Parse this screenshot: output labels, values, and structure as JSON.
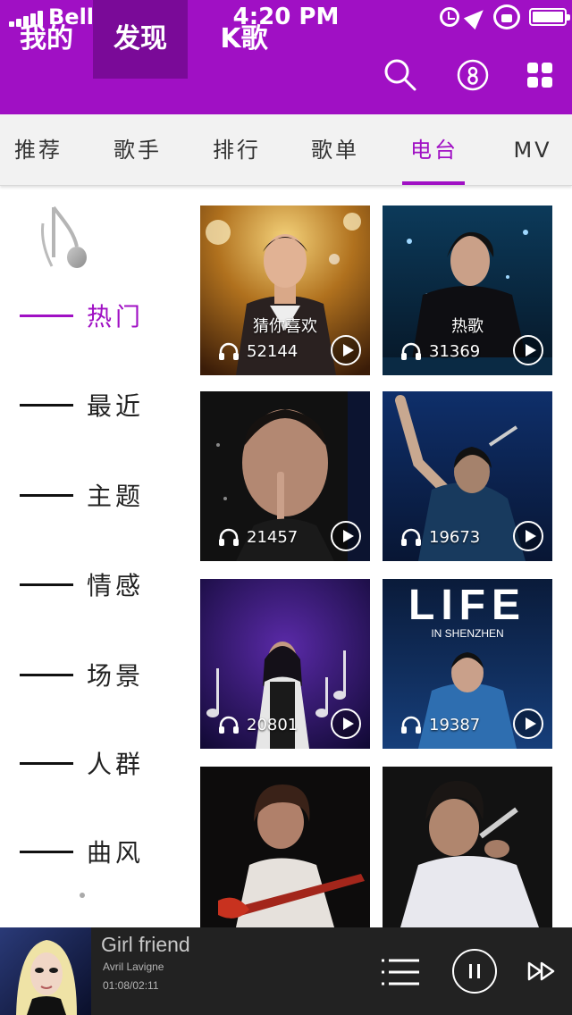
{
  "status_bar": {
    "carrier": "Bell",
    "time": "4:20 PM",
    "battery_level": 1.0
  },
  "header": {
    "tabs": [
      {
        "label": "我的",
        "active": false
      },
      {
        "label": "发现",
        "active": true
      },
      {
        "label": "K歌",
        "active": false
      }
    ],
    "icons": [
      "search-icon",
      "user-icon",
      "grid-menu-icon"
    ]
  },
  "category_tabs": {
    "items": [
      {
        "label": "推荐"
      },
      {
        "label": "歌手"
      },
      {
        "label": "排行"
      },
      {
        "label": "歌单"
      },
      {
        "label": "电台"
      },
      {
        "label": "MV"
      }
    ],
    "active_index": 4
  },
  "side_menu": {
    "items": [
      {
        "label": "热门"
      },
      {
        "label": "最近"
      },
      {
        "label": "主题"
      },
      {
        "label": "情感"
      },
      {
        "label": "场景"
      },
      {
        "label": "人群"
      },
      {
        "label": "曲风"
      }
    ],
    "active_index": 0
  },
  "cards": [
    {
      "title": "猜你喜欢",
      "plays": "52144"
    },
    {
      "title": "热歌",
      "plays": "31369"
    },
    {
      "title": "",
      "plays": "21457"
    },
    {
      "title": "",
      "plays": "19673"
    },
    {
      "title": "",
      "plays": "20801"
    },
    {
      "title": "",
      "plays": "19387",
      "poster_text": "LIFE",
      "poster_subtext": "IN SHENZHEN"
    },
    {
      "title": "",
      "plays": ""
    },
    {
      "title": "",
      "plays": ""
    }
  ],
  "player": {
    "song": "Girl friend",
    "artist": "Avril Lavigne",
    "progress": "01:08/02:11",
    "state": "playing"
  },
  "colors": {
    "accent": "#a010c4",
    "accent_dark": "#7a0a98",
    "player_bg": "#222222"
  }
}
